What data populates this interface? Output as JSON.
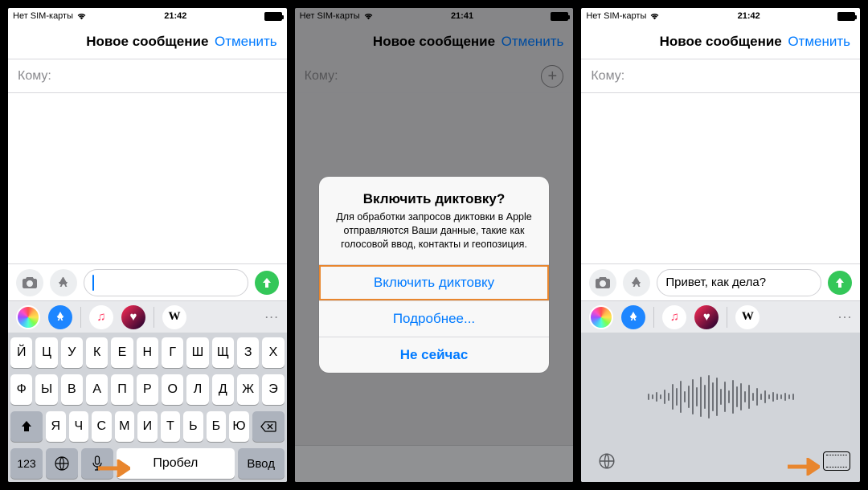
{
  "status": {
    "carrier": "Нет SIM-карты",
    "time1": "21:42",
    "time2": "21:41",
    "time3": "21:42"
  },
  "nav": {
    "title": "Новое сообщение",
    "cancel": "Отменить"
  },
  "to_label": "Кому:",
  "input": {
    "placeholder": "",
    "typed": "Привет, как дела?"
  },
  "apps": {
    "wiki": "W",
    "more": "···"
  },
  "keyboard": {
    "row1": [
      "Й",
      "Ц",
      "У",
      "К",
      "Е",
      "Н",
      "Г",
      "Ш",
      "Щ",
      "З",
      "Х"
    ],
    "row2": [
      "Ф",
      "Ы",
      "В",
      "А",
      "П",
      "Р",
      "О",
      "Л",
      "Д",
      "Ж",
      "Э"
    ],
    "row3": [
      "Я",
      "Ч",
      "С",
      "М",
      "И",
      "Т",
      "Ь",
      "Б",
      "Ю"
    ],
    "k123": "123",
    "space": "Пробел",
    "enter": "Ввод"
  },
  "alert": {
    "title": "Включить диктовку?",
    "message": "Для обработки запросов диктовки в Apple отправляются Ваши данные, такие как голосовой ввод, контакты и геопозиция.",
    "btn_enable": "Включить диктовку",
    "btn_more": "Подробнее...",
    "btn_later": "Не сейчас"
  },
  "wave_heights": [
    8,
    6,
    12,
    6,
    18,
    10,
    32,
    22,
    40,
    14,
    28,
    44,
    24,
    50,
    30,
    54,
    36,
    48,
    20,
    38,
    16,
    42,
    26,
    34,
    14,
    30,
    10,
    22,
    8,
    16,
    6,
    12,
    8,
    6,
    10,
    6,
    8
  ],
  "colors": {
    "accent": "#007aff",
    "send": "#34c759",
    "callout": "#e8862e"
  }
}
